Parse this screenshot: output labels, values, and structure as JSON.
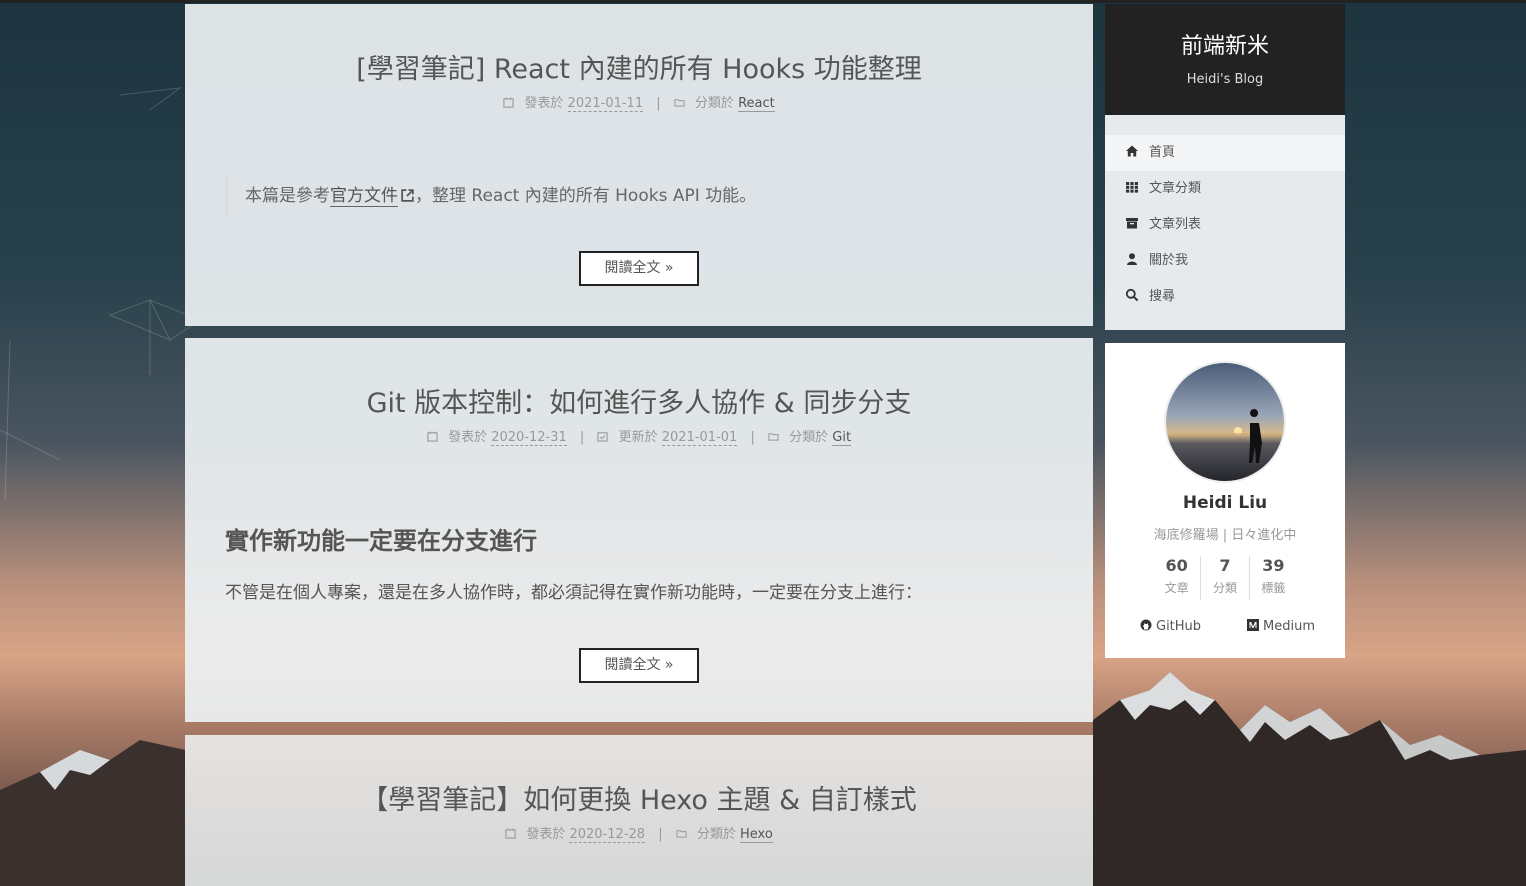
{
  "site": {
    "title": "前端新米",
    "subtitle": "Heidi's Blog"
  },
  "menu": [
    {
      "label": "首頁",
      "icon": "home-icon",
      "active": true
    },
    {
      "label": "文章分類",
      "icon": "grid-icon"
    },
    {
      "label": "文章列表",
      "icon": "archive-icon"
    },
    {
      "label": "關於我",
      "icon": "user-icon"
    },
    {
      "label": "搜尋",
      "icon": "search-icon"
    }
  ],
  "author": {
    "name": "Heidi Liu",
    "description": "海底修羅場 | 日々進化中",
    "stats": [
      {
        "count": "60",
        "label": "文章"
      },
      {
        "count": "7",
        "label": "分類"
      },
      {
        "count": "39",
        "label": "標籤"
      }
    ],
    "links": [
      {
        "label": "GitHub",
        "icon": "github-icon"
      },
      {
        "label": "Medium",
        "icon": "medium-icon"
      }
    ]
  },
  "posts": [
    {
      "title": "[學習筆記] React 內建的所有 Hooks 功能整理",
      "posted_label": "發表於",
      "posted_date": "2021-01-11",
      "category_label": "分類於",
      "category": "React",
      "excerpt_before": "本篇是參考",
      "excerpt_link": "官方文件",
      "excerpt_after": "，整理 React 內建的所有 Hooks API 功能。",
      "read_more": "閱讀全文 »"
    },
    {
      "title": "Git 版本控制：如何進行多人協作 & 同步分支",
      "posted_label": "發表於",
      "posted_date": "2020-12-31",
      "updated_label": "更新於",
      "updated_date": "2021-01-01",
      "category_label": "分類於",
      "category": "Git",
      "heading": "實作新功能一定要在分支進行",
      "paragraph": "不管是在個人專案，還是在多人協作時，都必須記得在實作新功能時，一定要在分支上進行：",
      "read_more": "閱讀全文 »"
    },
    {
      "title": "【學習筆記】如何更換 Hexo 主題 & 自訂樣式",
      "posted_label": "發表於",
      "posted_date": "2020-12-28",
      "category_label": "分類於",
      "category": "Hexo"
    }
  ],
  "colors": {
    "accent": "#222222",
    "background_top": "#1e3540",
    "background_glow": "#d9a487"
  }
}
